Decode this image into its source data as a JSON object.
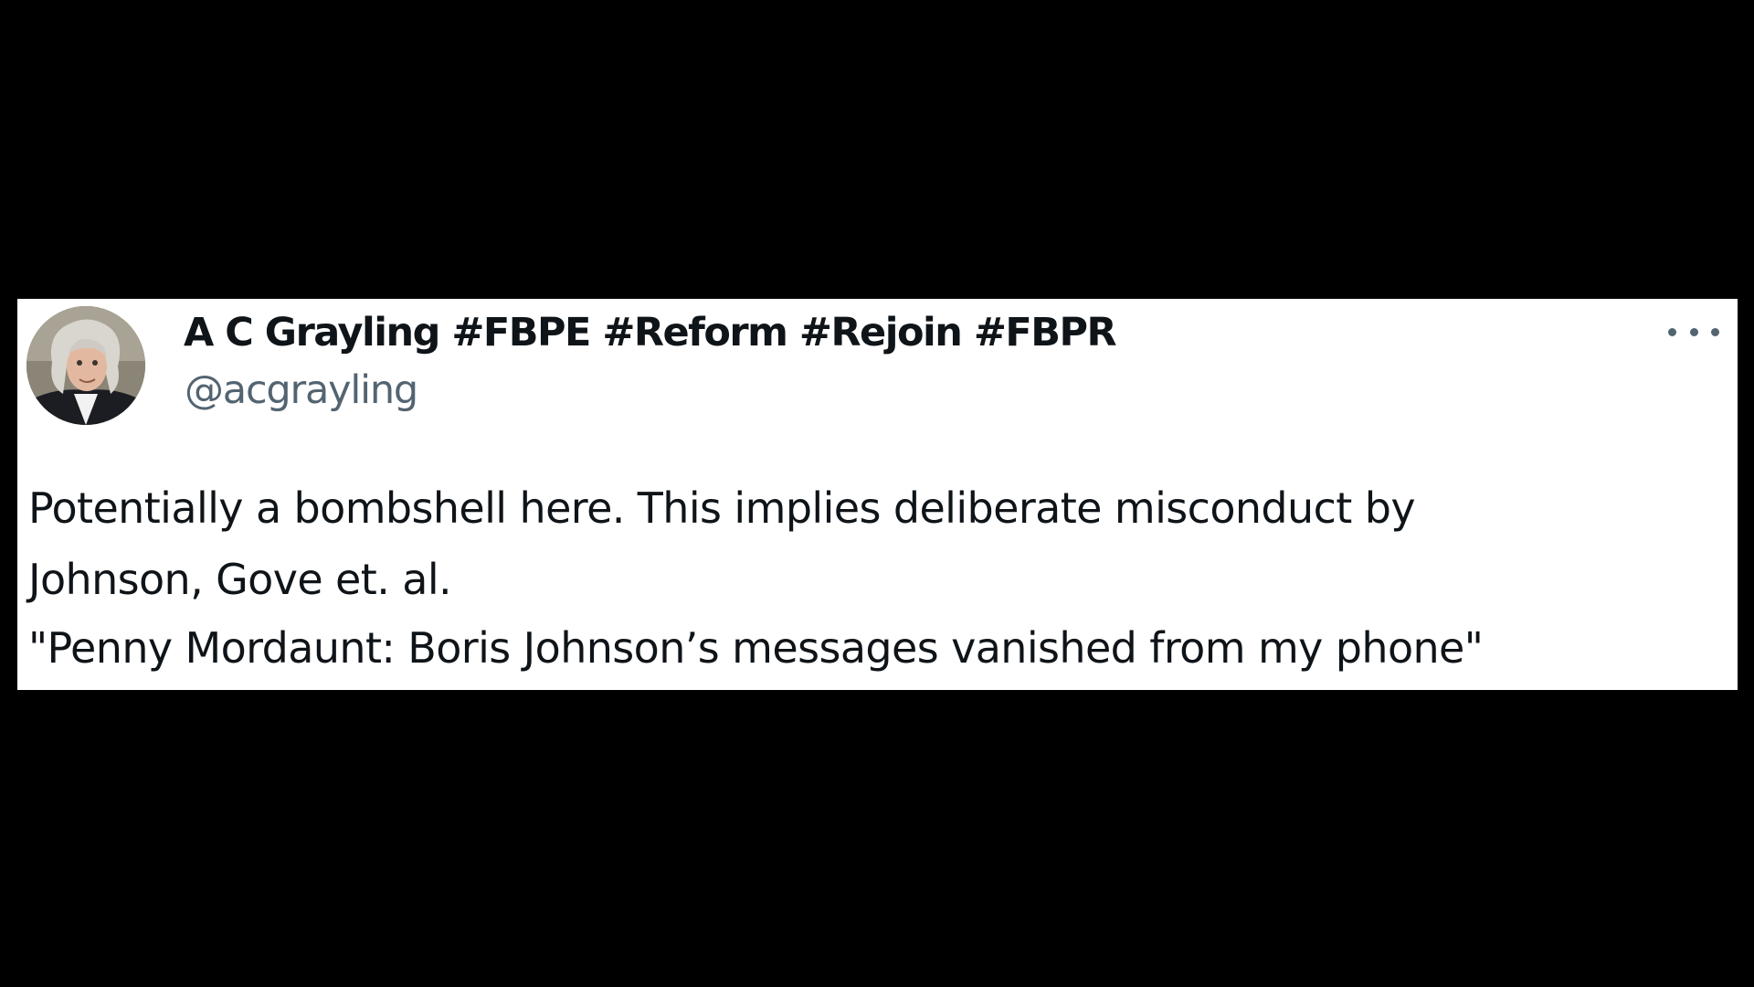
{
  "tweet": {
    "author": {
      "display_name": "A C Grayling #FBPE #Reform #Rejoin #FBPR",
      "handle": "@acgrayling",
      "avatar_icon": "profile-photo"
    },
    "more_icon": "more-horizontal-icon",
    "text_lines": [
      "Potentially a bombshell here. This implies deliberate misconduct by",
      "Johnson, Gove et. al.",
      "\"Penny Mordaunt: Boris Johnson’s messages vanished from my phone\""
    ]
  },
  "colors": {
    "background": "#000000",
    "card": "#ffffff",
    "text_primary": "#0f1419",
    "text_secondary": "#536471"
  }
}
